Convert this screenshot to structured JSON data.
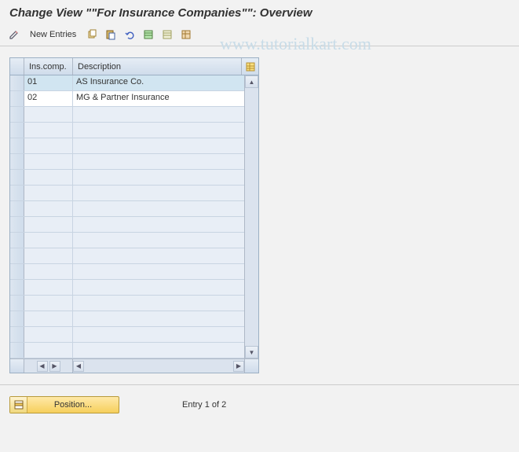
{
  "title": "Change View \"\"For Insurance Companies\"\": Overview",
  "watermark": "www.tutorialkart.com",
  "toolbar": {
    "new_entries_label": "New Entries",
    "icons": [
      "edit-icon",
      "copy-icon",
      "paste-icon",
      "undo-icon",
      "select-all-icon",
      "deselect-all-icon",
      "table-settings-icon"
    ]
  },
  "table": {
    "headers": {
      "ins": "Ins.comp.",
      "desc": "Description"
    },
    "rows": [
      {
        "ins": "01",
        "desc": "AS Insurance Co.",
        "selected": true
      },
      {
        "ins": "02",
        "desc": "MG & Partner Insurance",
        "selected": false
      }
    ],
    "empty_rows": 16
  },
  "footer": {
    "position_label": "Position...",
    "entry_status": "Entry 1 of 2"
  }
}
